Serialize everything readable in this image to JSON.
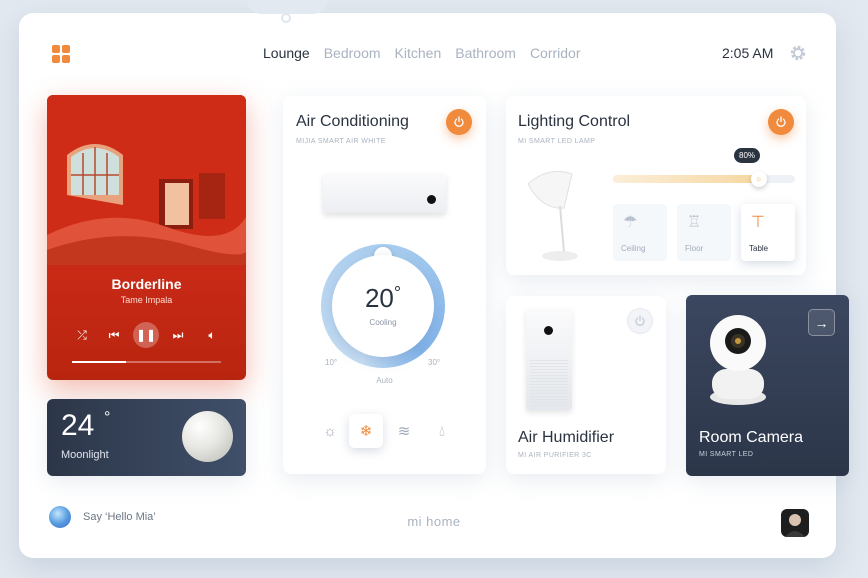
{
  "topbar": {
    "tabs": [
      {
        "label": "Lounge",
        "active": true
      },
      {
        "label": "Bedroom",
        "active": false
      },
      {
        "label": "Kitchen",
        "active": false
      },
      {
        "label": "Bathroom",
        "active": false
      },
      {
        "label": "Corridor",
        "active": false
      }
    ],
    "time": "2:05 AM"
  },
  "music": {
    "title": "Borderline",
    "artist": "Tame Impala",
    "progress": 0.36
  },
  "weather": {
    "temperature": "24",
    "degree": "°",
    "label": "Moonlight"
  },
  "ac": {
    "title": "Air Conditioning",
    "subtitle": "MIJIA SMART AIR WHITE",
    "power": "on",
    "temperature": "20",
    "degree": "°",
    "mode": "Cooling",
    "min": "10°",
    "max": "30°",
    "auto_label": "Auto",
    "modes": [
      "sun-icon",
      "snowflake-icon",
      "wind-icon",
      "droplet-icon"
    ],
    "active_mode": 1
  },
  "lighting": {
    "title": "Lighting Control",
    "subtitle": "MI SMART LED LAMP",
    "power": "on",
    "brightness_label": "80%",
    "brightness": 0.8,
    "buttons": [
      {
        "label": "Ceiling",
        "icon": "ceiling-light-icon",
        "active": false
      },
      {
        "label": "Floor",
        "icon": "floor-lamp-icon",
        "active": false
      },
      {
        "label": "Table",
        "icon": "table-lamp-icon",
        "active": true
      }
    ]
  },
  "humidifier": {
    "title": "Air Humidifier",
    "subtitle": "MI AIR PURIFIER 3C",
    "power": "off"
  },
  "camera": {
    "title": "Room Camera",
    "subtitle": "MI SMART LED"
  },
  "footer": {
    "assistant": "Say ‘Hello Mia’",
    "brand": "mi home"
  },
  "colors": {
    "accent": "#f08a3c",
    "text": "#2a3340",
    "muted": "#a9b3c0",
    "music_bg": "#d8301c",
    "dark_card": "#2c3648"
  }
}
